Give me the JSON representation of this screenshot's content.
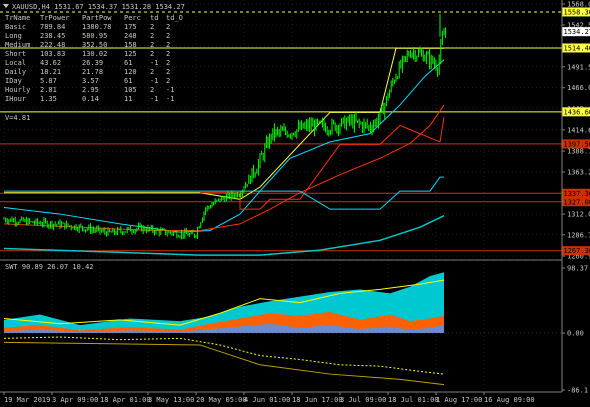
{
  "title": "XAUUSD,H4  1531.67 1534.37 1531.28 1534.27",
  "colors": {
    "background": "#000000",
    "grid": "#3a3a3a",
    "candle": "#00ff00",
    "ma_fast": "#00e0ff",
    "ma_slow": "#ff3000",
    "ma_long": "#00c8c8",
    "level_yellow": "#ffff40",
    "level_red": "#d03000",
    "swt_teal": "#00c8d0",
    "swt_orange": "#ff6000",
    "swt_blue": "#6a8cc8",
    "swt_yellow": "#ffff00",
    "price_text": "#c8c8c8"
  },
  "stats": {
    "headers": [
      "TrName",
      "TrPower",
      "PartPow",
      "Perc",
      "td",
      "td_O"
    ],
    "rows": [
      [
        "Basic",
        "789.84",
        "1380.78",
        "175",
        "2",
        "2"
      ],
      [
        "Long",
        "238.45",
        "580.95",
        "248",
        "2",
        "2"
      ],
      [
        "Medium",
        "222.48",
        "352.50",
        "158",
        "2",
        "2"
      ],
      [
        "Short",
        "103.83",
        "130.02",
        "125",
        "2",
        "2"
      ],
      [
        "Local",
        "43.62",
        "26.39",
        "61",
        "-1",
        "2"
      ],
      [
        "Daily",
        "18.21",
        "21.78",
        "120",
        "2",
        "2"
      ],
      [
        "IDay",
        "5.87",
        "3.57",
        "61",
        "-1",
        "2"
      ],
      [
        "Hourly",
        "2.81",
        "2.95",
        "105",
        "2",
        "-1"
      ],
      [
        "IHour",
        "1.35",
        "0.14",
        "11",
        "-1",
        "-1"
      ]
    ],
    "volatility": "V=4.81"
  },
  "price_axis": {
    "ticks": [
      "1568.00",
      "1542.50",
      "1517.10",
      "1491.50",
      "1466.00",
      "1440.40",
      "1414.65",
      "1388.75",
      "1363.25",
      "1337.65",
      "1312.05",
      "1286.75",
      "1260.90"
    ],
    "tags": [
      {
        "label": "1558.30",
        "color": "#ffff40"
      },
      {
        "label": "1534.27",
        "color": "#ffffff"
      },
      {
        "label": "1514.40",
        "color": "#ffff40"
      },
      {
        "label": "1436.60",
        "color": "#ffff40"
      },
      {
        "label": "1397.50",
        "color": "#d03000"
      },
      {
        "label": "1337.36",
        "color": "#d03000"
      },
      {
        "label": "1327.00",
        "color": "#d03000"
      },
      {
        "label": "1267.36",
        "color": "#d03000"
      }
    ]
  },
  "indicator": {
    "label": "SWT 90.89 26.07 10.42",
    "ticks": [
      "98.37",
      "0.00",
      "-86.1"
    ]
  },
  "time_axis": [
    "19 Mar 2019",
    "3 Apr 09:00",
    "18 Apr 01:00",
    "3 May 13:00",
    "20 May 05:00",
    "4 Jun 01:00",
    "18 Jun 17:00",
    "3 Jul 09:00",
    "18 Jul 01:00",
    "1 Aug 17:00",
    "16 Aug 09:00"
  ]
}
